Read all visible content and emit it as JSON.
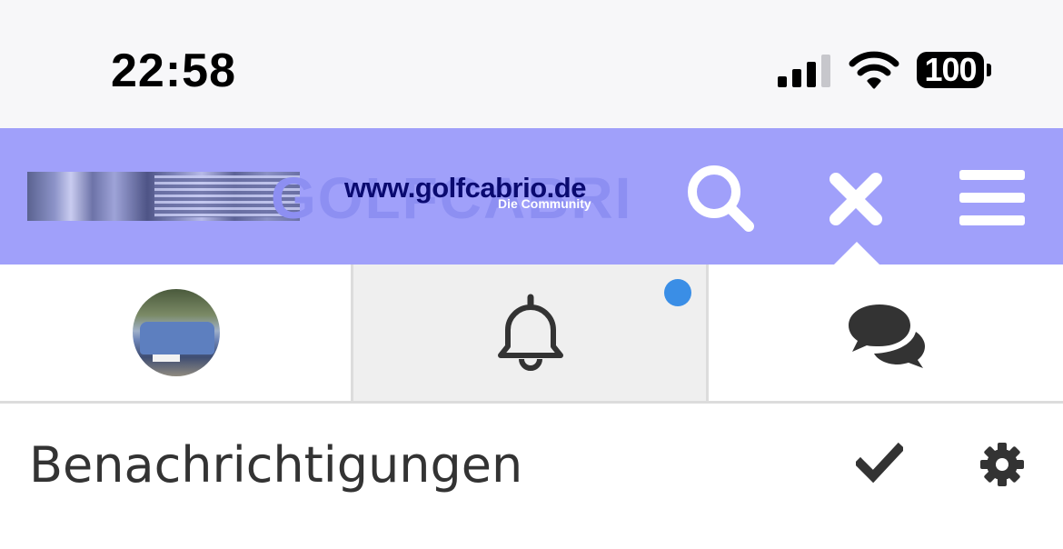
{
  "status_bar": {
    "time": "22:58",
    "battery": "100",
    "icons": [
      "signal-icon",
      "wifi-icon",
      "battery-icon"
    ]
  },
  "header": {
    "logo": {
      "background_text": "GOLFCABRIO.DE",
      "url_text": "www.golfcabrio.de",
      "subtitle": "Die Community"
    },
    "buttons": [
      "search-icon",
      "close-icon",
      "menu-icon"
    ],
    "background_color": "#a0a0fa"
  },
  "tabs": [
    {
      "id": "profile",
      "icon": "avatar"
    },
    {
      "id": "notifications",
      "icon": "bell-icon",
      "active": true,
      "has_unread": true
    },
    {
      "id": "messages",
      "icon": "chat-bubbles-icon"
    }
  ],
  "panel": {
    "title": "Benachrichtigungen",
    "actions": [
      "checkmark-icon",
      "gear-icon"
    ]
  },
  "colors": {
    "accent_dot": "#3a8ee6",
    "text": "#333333"
  }
}
